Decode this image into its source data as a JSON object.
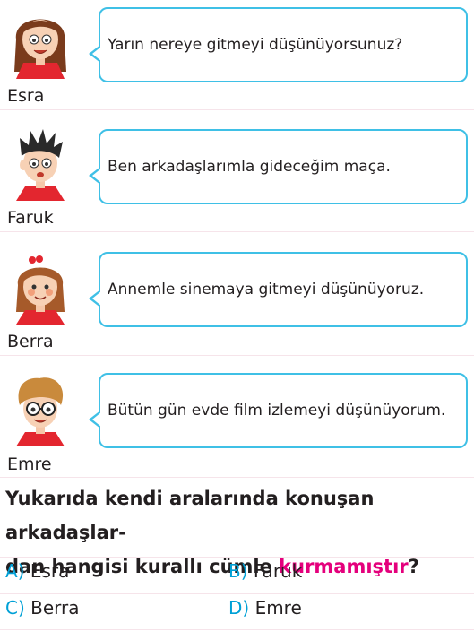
{
  "dialogue": [
    {
      "name": "Esra",
      "text": "Yarın nereye gitmeyi düşünüyorsunuz?"
    },
    {
      "name": "Faruk",
      "text": "Ben arkadaşlarımla gideceğim maça."
    },
    {
      "name": "Berra",
      "text": "Annemle sinemaya gitmeyi düşünüyoruz."
    },
    {
      "name": "Emre",
      "text": "Bütün gün evde film izlemeyi düşünüyorum."
    }
  ],
  "question": {
    "part1": "Yukarıda kendi aralarında konuşan arkadaşlar-",
    "part2": "dan hangisi kurallı cümle ",
    "highlight": "kurmamıştır",
    "end": "?"
  },
  "options": [
    {
      "letter": "A)",
      "answer": "Esra"
    },
    {
      "letter": "B)",
      "answer": "Faruk"
    },
    {
      "letter": "C)",
      "answer": "Berra"
    },
    {
      "letter": "D)",
      "answer": "Emre"
    }
  ],
  "colors": {
    "bubble_border": "#3fc0e6",
    "highlight": "#e4007c",
    "option_letter": "#00a0d6",
    "shirt": "#e3262f"
  }
}
